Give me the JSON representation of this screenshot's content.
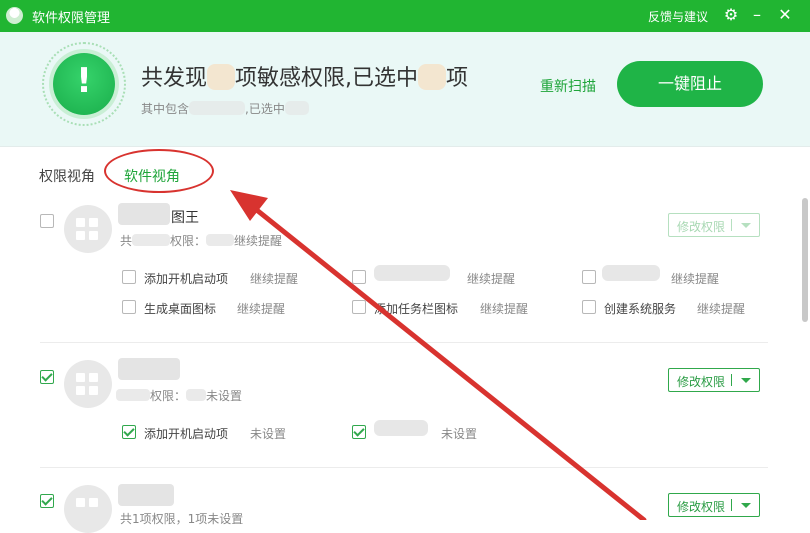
{
  "titlebar": {
    "title": "软件权限管理",
    "feedback": "反馈与建议"
  },
  "header": {
    "headline_prefix": "共发现",
    "headline_mid": "项敏感权限,已选中",
    "headline_suffix": "项",
    "sub_prefix": "其中包含",
    "sub_mid": "已选中",
    "rescan": "重新扫描",
    "block_all": "一键阻止"
  },
  "tabs": {
    "perm_view": "权限视角",
    "software_view": "软件视角"
  },
  "apps": [
    {
      "checked": false,
      "name": "图王",
      "summary_prefix": "共",
      "summary_mid": "权限：",
      "summary_suffix": "继续提醒",
      "modify": "修改权限",
      "perms": [
        {
          "label": "添加开机启动项",
          "status": "继续提醒",
          "checked": false
        },
        {
          "label": "",
          "status": "继续提醒",
          "checked": false
        },
        {
          "label": "",
          "status": "继续提醒",
          "checked": false
        },
        {
          "label": "生成桌面图标",
          "status": "继续提醒",
          "checked": false
        },
        {
          "label": "添加任务栏图标",
          "status": "继续提醒",
          "checked": false
        },
        {
          "label": "创建系统服务",
          "status": "继续提醒",
          "checked": false
        }
      ]
    },
    {
      "checked": true,
      "name": "",
      "summary_mid": "权限：",
      "summary_suffix": "未设置",
      "modify": "修改权限",
      "perms": [
        {
          "label": "添加开机启动项",
          "status": "未设置",
          "checked": true
        },
        {
          "label": "",
          "status": "未设置",
          "checked": true
        }
      ]
    },
    {
      "checked": true,
      "name": "",
      "summary": "共1项权限，1项未设置",
      "modify": "修改权限"
    }
  ],
  "colors": {
    "brand": "#21b532",
    "accent_text": "#1fa53a",
    "annotation": "#d8332f"
  }
}
